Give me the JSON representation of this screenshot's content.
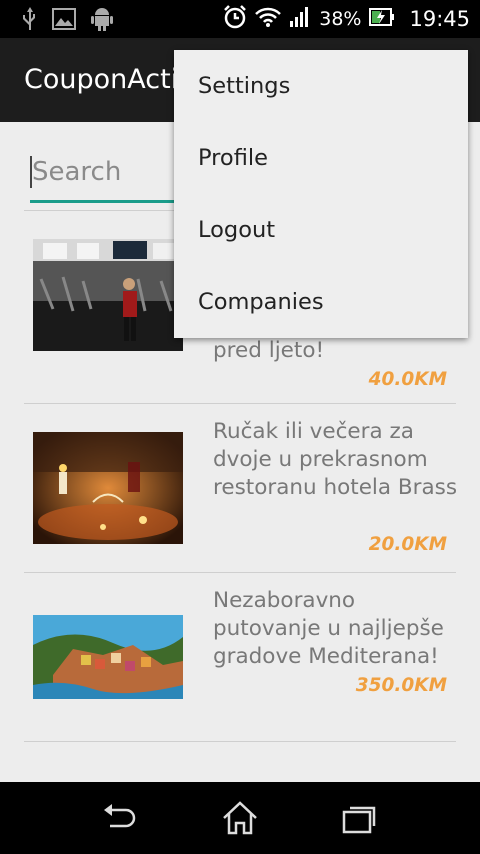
{
  "status_bar": {
    "battery_percent": "38%",
    "time": "19:45",
    "icons": [
      "usb-icon",
      "image-icon",
      "android-icon",
      "alarm-icon",
      "wifi-icon",
      "signal-icon",
      "battery-charging-icon"
    ]
  },
  "app_bar": {
    "title": "CouponActivity"
  },
  "search": {
    "placeholder": "Search",
    "value": ""
  },
  "coupons": [
    {
      "title": "pred ljeto!",
      "price": "40.0KM",
      "image": "gym-photo"
    },
    {
      "title": "Ručak ili večera za dvoje u prekrasnom restoranu hotela Brass",
      "price": "20.0KM",
      "image": "candlelit-dinner-photo"
    },
    {
      "title": "Nezaboravno putovanje u najljepše gradove Mediterana!",
      "price": "350.0KM",
      "image": "coastal-village-photo"
    }
  ],
  "overflow_menu": {
    "items": [
      "Settings",
      "Profile",
      "Logout",
      "Companies"
    ]
  },
  "colors": {
    "accent": "#1a9c8a",
    "price": "#f0a040",
    "app_bar": "#1d1d1d",
    "background": "#ededed"
  },
  "nav_bar": {
    "icons": [
      "back-icon",
      "home-icon",
      "recents-icon"
    ]
  }
}
